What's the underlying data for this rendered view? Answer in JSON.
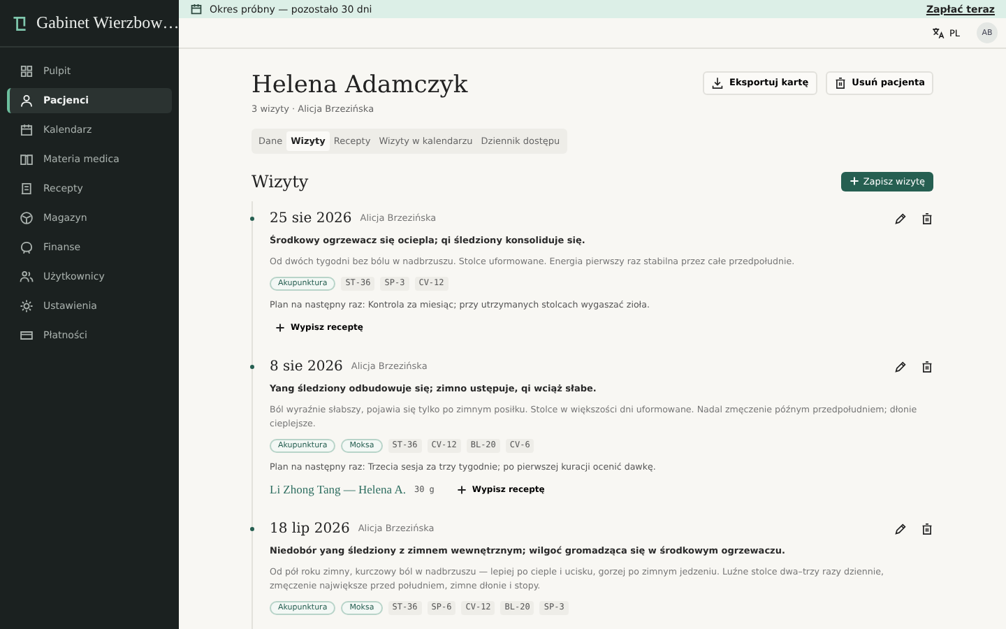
{
  "sidebar": {
    "title": "Gabinet Wierzbow…",
    "items": [
      {
        "label": "Pulpit",
        "selected": false
      },
      {
        "label": "Pacjenci",
        "selected": true
      },
      {
        "label": "Kalendarz",
        "selected": false
      },
      {
        "label": "Materia medica",
        "selected": false
      },
      {
        "label": "Recepty",
        "selected": false
      },
      {
        "label": "Magazyn",
        "selected": false
      },
      {
        "label": "Finanse",
        "selected": false
      },
      {
        "label": "Użytkownicy",
        "selected": false
      },
      {
        "label": "Ustawienia",
        "selected": false
      },
      {
        "label": "Płatności",
        "selected": false
      }
    ]
  },
  "banner": {
    "text": "Okres próbny — pozostało 30 dni",
    "link": "Zapłać teraz"
  },
  "header": {
    "language": "PL",
    "avatar": "AB"
  },
  "patient": {
    "name": "Helena Adamczyk",
    "subtitle": "3 wizyty · Alicja Brzezińska",
    "actions": [
      "Eksportuj kartę",
      "Usuń pacjenta"
    ]
  },
  "tabs": [
    {
      "label": "Dane",
      "selected": false
    },
    {
      "label": "Wizyty",
      "selected": true
    },
    {
      "label": "Recepty",
      "selected": false
    },
    {
      "label": "Wizyty w kalendarzu",
      "selected": false
    },
    {
      "label": "Dziennik dostępu",
      "selected": false
    }
  ],
  "visits_section": {
    "title": "Wizyty",
    "add_button": "Zapisz wizytę"
  },
  "visits": [
    {
      "date": "25 sie 2026",
      "author": "Alicja Brzezińska",
      "summary": "Środkowy ogrzewacz się ociepla; qi śledziony konsoliduje się.",
      "note": "Od dwóch tygodni bez bólu w nadbrzuszu. Stolce uformowane. Energia pierwszy raz stabilna przez całe przedpołudnie.",
      "tags": [
        {
          "kind": "method",
          "label": "Akupunktura"
        },
        {
          "kind": "point",
          "label": "ST-36"
        },
        {
          "kind": "point",
          "label": "SP-3"
        },
        {
          "kind": "point",
          "label": "CV-12"
        }
      ],
      "plan": "Plan na następny raz: Kontrola za miesiąc; przy utrzymanych stolcach wygaszać zioła.",
      "prescribe_button": "Wypisz receptę"
    },
    {
      "date": "8 sie 2026",
      "author": "Alicja Brzezińska",
      "summary": "Yang śledziony odbudowuje się; zimno ustępuje, qi wciąż słabe.",
      "note": "Ból wyraźnie słabszy, pojawia się tylko po zimnym posiłku. Stolce w większości dni uformowane. Nadal zmęczenie późnym przedpołudniem; dłonie cieplejsze.",
      "tags": [
        {
          "kind": "method",
          "label": "Akupunktura"
        },
        {
          "kind": "method",
          "label": "Moksa"
        },
        {
          "kind": "point",
          "label": "ST-36"
        },
        {
          "kind": "point",
          "label": "CV-12"
        },
        {
          "kind": "point",
          "label": "BL-20"
        },
        {
          "kind": "point",
          "label": "CV-6"
        }
      ],
      "plan": "Plan na następny raz: Trzecia sesja za trzy tygodnie; po pierwszej kuracji ocenić dawkę.",
      "prescription": {
        "name": "Li Zhong Tang — Helena A.",
        "dose": "30 g"
      },
      "prescribe_button": "Wypisz receptę"
    },
    {
      "date": "18 lip 2026",
      "author": "Alicja Brzezińska",
      "summary": "Niedobór yang śledziony z zimnem wewnętrznym; wilgoć gromadząca się w środkowym ogrzewaczu.",
      "note": "Od pół roku zimny, kurczowy ból w nadbrzuszu — lepiej po cieple i ucisku, gorzej po zimnym jedzeniu. Luźne stolce dwa–trzy razy dziennie, zmęczenie największe przed południem, zimne dłonie i stopy.",
      "tags": [
        {
          "kind": "method",
          "label": "Akupunktura"
        },
        {
          "kind": "method",
          "label": "Moksa"
        },
        {
          "kind": "point",
          "label": "ST-36"
        },
        {
          "kind": "point",
          "label": "SP-6"
        },
        {
          "kind": "point",
          "label": "CV-12"
        },
        {
          "kind": "point",
          "label": "BL-20"
        },
        {
          "kind": "point",
          "label": "SP-3"
        }
      ]
    }
  ]
}
